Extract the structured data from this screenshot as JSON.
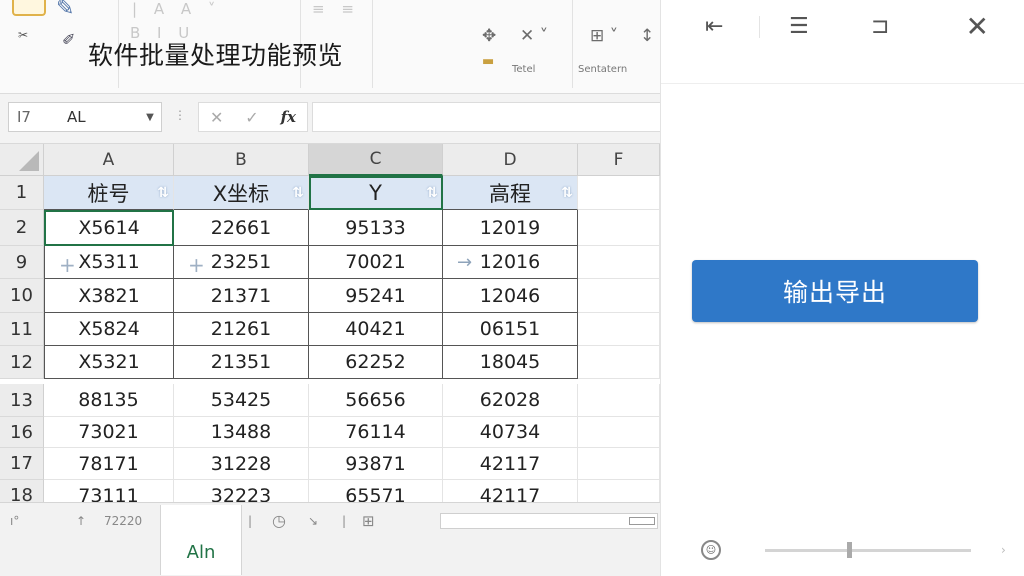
{
  "app": {
    "title": "软件批量处理功能预览"
  },
  "ribbon": {
    "labels": [
      "Tetel",
      "Sentatern"
    ]
  },
  "formula_bar": {
    "name_prefix": "I7",
    "name_ref": "AL",
    "fx": "fx"
  },
  "grid": {
    "columns": [
      "A",
      "B",
      "C",
      "D",
      "F"
    ],
    "active_column": "C",
    "header_row": {
      "row": "1",
      "cells": [
        "桩号",
        "X坐标",
        "Y",
        "高程"
      ]
    },
    "rows": [
      {
        "row": "2",
        "cells": [
          "X5614",
          "22661",
          "95133",
          "12019"
        ]
      },
      {
        "row": "9",
        "cells": [
          "X5311",
          "23251",
          "70021",
          "12016"
        ]
      },
      {
        "row": "10",
        "cells": [
          "X3821",
          "21371",
          "95241",
          "12046"
        ]
      },
      {
        "row": "11",
        "cells": [
          "X5824",
          "21261",
          "40421",
          "06151"
        ]
      },
      {
        "row": "12",
        "cells": [
          "X5321",
          "21351",
          "62252",
          "18045"
        ]
      },
      {
        "row": "13",
        "cells": [
          "88135",
          "53425",
          "56656",
          "62028"
        ]
      },
      {
        "row": "16",
        "cells": [
          "73021",
          "13488",
          "76114",
          "40734"
        ]
      },
      {
        "row": "17",
        "cells": [
          "78171",
          "31228",
          "93871",
          "42117"
        ]
      },
      {
        "row": "18",
        "cells": [
          "73111",
          "32223",
          "65571",
          "42117"
        ]
      }
    ],
    "selected_cell": "A2"
  },
  "sheet": {
    "tab_label": "Aln",
    "strip_text": "72220"
  },
  "pane": {
    "export_label": "输出导出",
    "accent": "#2f78c8"
  },
  "colors": {
    "excel_green": "#217346",
    "header_fill": "#dbe6f4"
  },
  "icons": [
    "paste-icon",
    "brush-icon",
    "cut-icon",
    "format-painter-icon",
    "fx-icon",
    "cancel-icon",
    "enter-icon",
    "align-icon",
    "layout-icon",
    "restore-icon",
    "close-icon",
    "feedback-icon",
    "clock-icon",
    "grid-icon"
  ]
}
